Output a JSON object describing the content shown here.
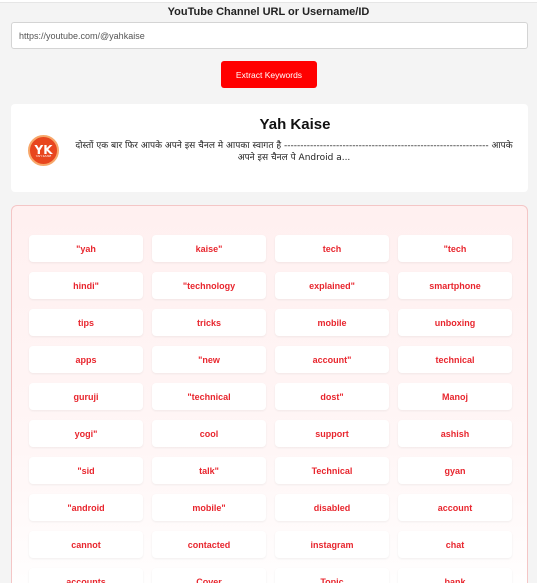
{
  "form": {
    "label": "YouTube Channel URL or Username/ID",
    "url_value": "https://youtube.com/@yahkaise",
    "extract_label": "Extract Keywords"
  },
  "channel": {
    "name": "Yah Kaise",
    "logo_text": "YK",
    "logo_subtext": "YAH KAISE",
    "description": "दोस्तों एक बार फिर आपके अपने इस चैनल मे आपका स्वागत है --------------------------------------------------------------- आपके अपने इस चैनल पे Android a..."
  },
  "colors": {
    "accent": "#ff0000",
    "keyword_text": "#e8262e"
  },
  "keywords": [
    "\"yah",
    "kaise\"",
    "tech",
    "\"tech",
    "hindi\"",
    "\"technology",
    "explained\"",
    "smartphone",
    "tips",
    "tricks",
    "mobile",
    "unboxing",
    "apps",
    "\"new",
    "account\"",
    "technical",
    "guruji",
    "\"technical",
    "dost\"",
    "Manoj",
    "yogi\"",
    "cool",
    "support",
    "ashish",
    "\"sid",
    "talk\"",
    "Technical",
    "gyan",
    "\"android",
    "mobile\"",
    "disabled",
    "account",
    "cannot",
    "contacted",
    "instagram",
    "chat",
    "accounts",
    "Cover",
    "Topic",
    "bank"
  ]
}
